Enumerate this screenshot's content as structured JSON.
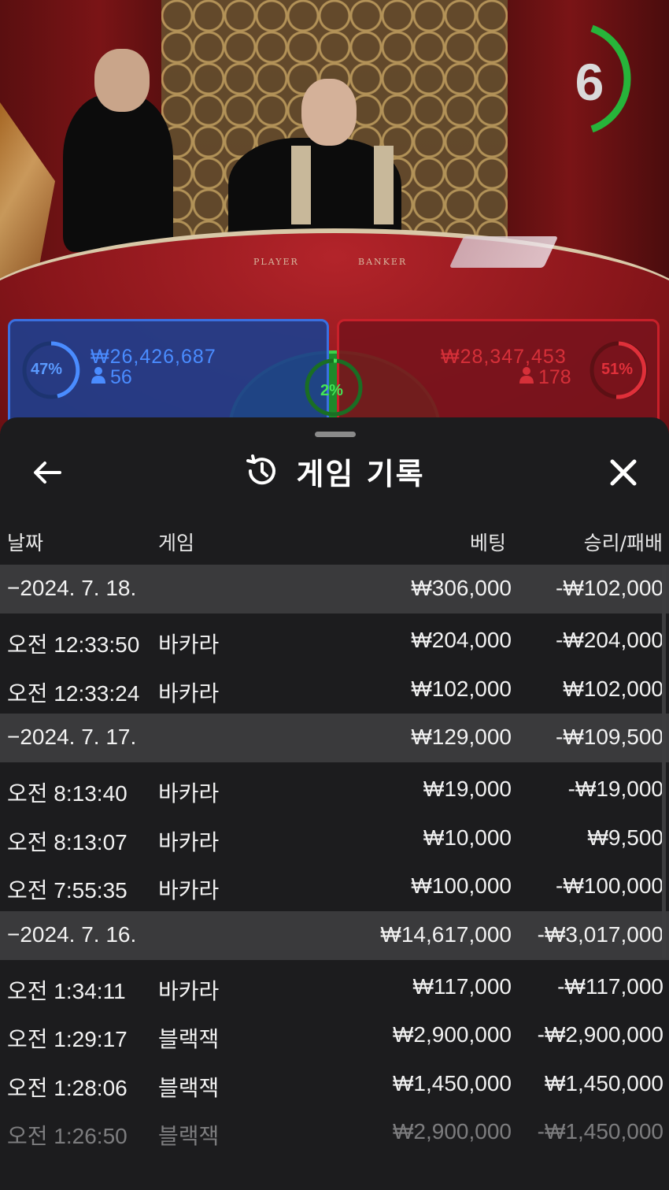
{
  "stream": {
    "countdown": "6",
    "table_labels": {
      "player": "PLAYER",
      "banker": "BANKER"
    },
    "player": {
      "percent": "47%",
      "amount": "₩26,426,687",
      "count": "56",
      "color": "#3a70e0"
    },
    "tie": {
      "percent": "2%",
      "color": "#3bd04a"
    },
    "banker": {
      "percent": "51%",
      "amount": "₩28,347,453",
      "count": "178",
      "color": "#c8202a"
    }
  },
  "sheet": {
    "title": "게임 기록",
    "back_icon": "arrow-left-icon",
    "history_icon": "history-icon",
    "close_icon": "close-icon",
    "columns": {
      "date": "날짜",
      "game": "게임",
      "bet": "베팅",
      "result": "승리/패배"
    },
    "groups": [
      {
        "date": "−2024. 7. 18.",
        "bet_total": "₩306,000",
        "result_total": "-₩102,000",
        "rows": [
          {
            "time": "오전 12:33:50",
            "game": "바카라",
            "bet": "₩204,000",
            "result": "-₩204,000"
          },
          {
            "time": "오전 12:33:24",
            "game": "바카라",
            "bet": "₩102,000",
            "result": "₩102,000"
          }
        ]
      },
      {
        "date": "−2024. 7. 17.",
        "bet_total": "₩129,000",
        "result_total": "-₩109,500",
        "rows": [
          {
            "time": "오전 8:13:40",
            "game": "바카라",
            "bet": "₩19,000",
            "result": "-₩19,000"
          },
          {
            "time": "오전 8:13:07",
            "game": "바카라",
            "bet": "₩10,000",
            "result": "₩9,500"
          },
          {
            "time": "오전 7:55:35",
            "game": "바카라",
            "bet": "₩100,000",
            "result": "-₩100,000"
          }
        ]
      },
      {
        "date": "−2024. 7. 16.",
        "bet_total": "₩14,617,000",
        "result_total": "-₩3,017,000",
        "rows": [
          {
            "time": "오전 1:34:11",
            "game": "바카라",
            "bet": "₩117,000",
            "result": "-₩117,000"
          },
          {
            "time": "오전 1:29:17",
            "game": "블랙잭",
            "bet": "₩2,900,000",
            "result": "-₩2,900,000"
          },
          {
            "time": "오전 1:28:06",
            "game": "블랙잭",
            "bet": "₩1,450,000",
            "result": "₩1,450,000"
          },
          {
            "time": "오전 1:26:50",
            "game": "블랙잭",
            "bet": "₩2,900,000",
            "result": "-₩1,450,000"
          }
        ]
      }
    ]
  }
}
